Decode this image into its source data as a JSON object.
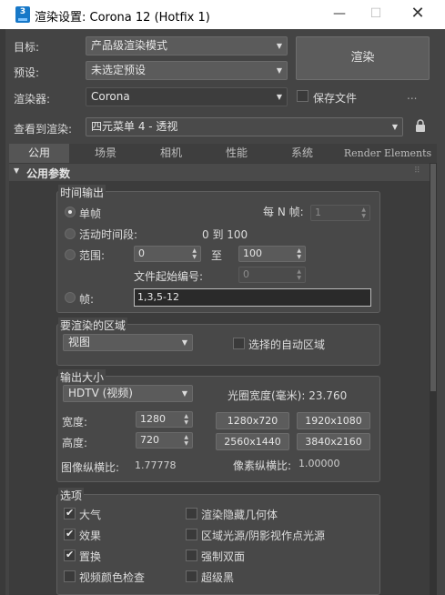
{
  "window": {
    "app_icon_text": "3",
    "title": "渲染设置: Corona 12 (Hotfix 1)",
    "minimize": "—",
    "maximize": "☐",
    "close": "✕"
  },
  "header": {
    "target_label": "目标:",
    "target_value": "产品级渲染模式",
    "preset_label": "预设:",
    "preset_value": "未选定预设",
    "renderer_label": "渲染器:",
    "renderer_value": "Corona",
    "save_file_label": "保存文件",
    "more_dots": "...",
    "view_label": "查看到渲染:",
    "view_value": "四元菜单 4 - 透视",
    "render_button": "渲染"
  },
  "tabs": [
    {
      "label": "公用",
      "active": true
    },
    {
      "label": "场景",
      "active": false
    },
    {
      "label": "相机",
      "active": false
    },
    {
      "label": "性能",
      "active": false
    },
    {
      "label": "系统",
      "active": false
    },
    {
      "label": "Render Elements",
      "active": false
    }
  ],
  "rollout": {
    "toggle": "▼",
    "title": "公用参数",
    "grip": "⠿"
  },
  "time_output": {
    "title": "时间输出",
    "single_label": "单帧",
    "every_n_label": "每 N 帧:",
    "every_n_value": "1",
    "active_segment_label": "活动时间段:",
    "active_segment_range": "0 到 100",
    "range_label": "范围:",
    "range_from": "0",
    "range_to_label": "至",
    "range_to": "100",
    "file_start_label": "文件起始编号:",
    "file_start_value": "0",
    "frames_label": "帧:",
    "frames_value": "1,3,5-12"
  },
  "render_area": {
    "title": "要渲染的区域",
    "view_value": "视图",
    "auto_region_label": "选择的自动区域"
  },
  "output_size": {
    "title": "输出大小",
    "format_value": "HDTV (视频)",
    "aperture_label": "光圈宽度(毫米): 23.760",
    "width_label": "宽度:",
    "width_value": "1280",
    "height_label": "高度:",
    "height_value": "720",
    "presets": [
      "1280x720",
      "1920x1080",
      "2560x1440",
      "3840x2160"
    ],
    "image_aspect_label": "图像纵横比:",
    "image_aspect_value": "1.77778",
    "pixel_aspect_label": "像素纵横比:",
    "pixel_aspect_value": "1.00000"
  },
  "options": {
    "title": "选项",
    "left": [
      {
        "label": "大气",
        "checked": true
      },
      {
        "label": "效果",
        "checked": true
      },
      {
        "label": "置换",
        "checked": true
      },
      {
        "label": "视频颜色检查",
        "checked": false
      }
    ],
    "right": [
      {
        "label": "渲染隐藏几何体",
        "checked": false
      },
      {
        "label": "区域光源/阴影视作点光源",
        "checked": false
      },
      {
        "label": "强制双面",
        "checked": false
      },
      {
        "label": "超级黑",
        "checked": false
      }
    ]
  }
}
